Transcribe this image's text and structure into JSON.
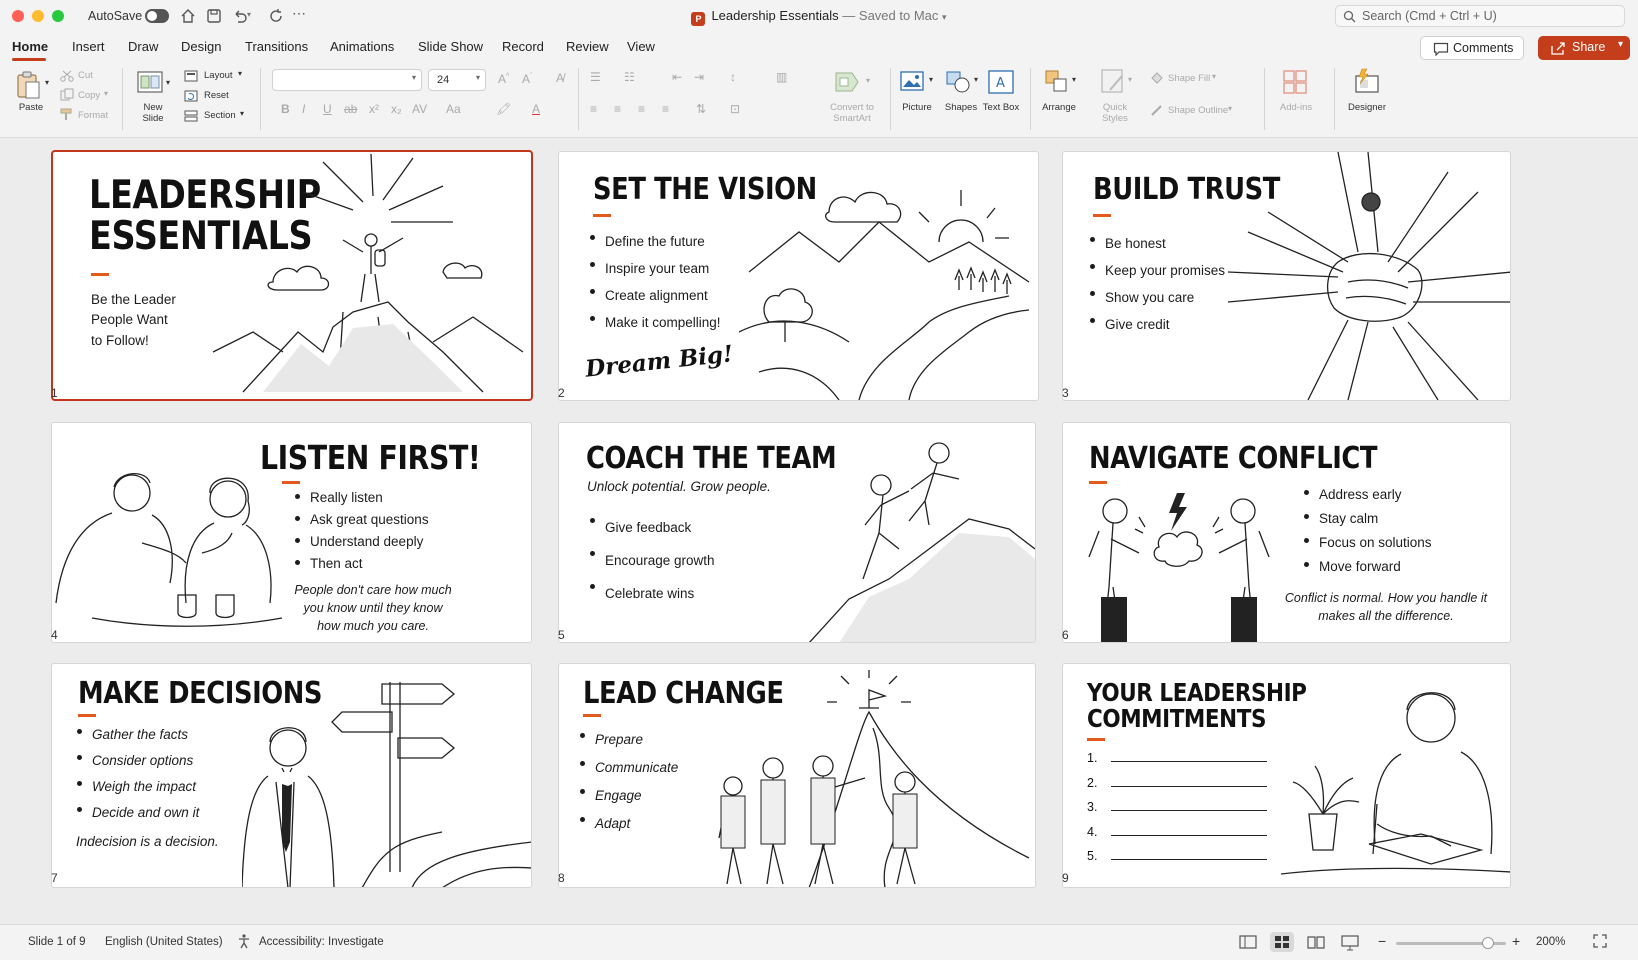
{
  "titlebar": {
    "autosave_label": "AutoSave",
    "document_title": "Leadership Essentials",
    "save_status": "— Saved to Mac",
    "search_placeholder": "Search (Cmd + Ctrl + U)"
  },
  "tabs": [
    "Home",
    "Insert",
    "Draw",
    "Design",
    "Transitions",
    "Animations",
    "Slide Show",
    "Record",
    "Review",
    "View"
  ],
  "active_tab": "Home",
  "header_buttons": {
    "comments": "Comments",
    "share": "Share"
  },
  "ribbon": {
    "paste": "Paste",
    "cut": "Cut",
    "copy": "Copy",
    "format": "Format",
    "new_slide": "New Slide",
    "layout": "Layout",
    "reset": "Reset",
    "section": "Section",
    "font_name": "",
    "font_size": "24",
    "convert_smartart": "Convert to SmartArt",
    "picture": "Picture",
    "shapes": "Shapes",
    "text_box": "Text Box",
    "arrange": "Arrange",
    "quick_styles": "Quick Styles",
    "shape_fill": "Shape Fill",
    "shape_outline": "Shape Outline",
    "add_ins": "Add-ins",
    "designer": "Designer"
  },
  "slides": [
    {
      "number": "1",
      "title_l1": "LEADERSHIP",
      "title_l2": "ESSENTIALS",
      "subtitle": [
        "Be the Leader",
        "People Want",
        "to Follow!"
      ]
    },
    {
      "number": "2",
      "title": "SET THE VISION",
      "bullets": [
        "Define the future",
        "Inspire your team",
        "Create alignment",
        "Make it compelling!"
      ],
      "script_text": "Dream Big!"
    },
    {
      "number": "3",
      "title": "BUILD TRUST",
      "bullets": [
        "Be honest",
        "Keep your promises",
        "Show you care",
        "Give credit"
      ]
    },
    {
      "number": "4",
      "title": "LISTEN FIRST!",
      "bullets": [
        "Really listen",
        "Ask great questions",
        "Understand deeply",
        "Then act"
      ],
      "quote": [
        "People don't care how much",
        "you know until they know",
        "how much you care."
      ]
    },
    {
      "number": "5",
      "title": "COACH THE TEAM",
      "tagline": "Unlock potential. Grow people.",
      "bullets": [
        "Give feedback",
        "Encourage growth",
        "Celebrate wins"
      ]
    },
    {
      "number": "6",
      "title": "NAVIGATE CONFLICT",
      "bullets": [
        "Address early",
        "Stay calm",
        "Focus on solutions",
        "Move forward"
      ],
      "quote": [
        "Conflict is normal. How you handle it",
        "makes all the difference."
      ]
    },
    {
      "number": "7",
      "title": "MAKE DECISIONS",
      "bullets": [
        "Gather the facts",
        "Consider options",
        "Weigh the impact",
        "Decide and own it"
      ],
      "closing": "Indecision is a decision."
    },
    {
      "number": "8",
      "title": "LEAD CHANGE",
      "bullets": [
        "Prepare",
        "Communicate",
        "Engage",
        "Adapt"
      ]
    },
    {
      "number": "9",
      "title_l1": "YOUR LEADERSHIP",
      "title_l2": "COMMITMENTS",
      "lines": [
        "1.",
        "2.",
        "3.",
        "4.",
        "5."
      ]
    }
  ],
  "status": {
    "slide_indicator": "Slide 1 of 9",
    "language": "English (United States)",
    "accessibility": "Accessibility: Investigate",
    "zoom": "200%"
  },
  "colors": {
    "accent": "#c43e1c",
    "slide_bar": "#e25a1c",
    "selection": "#c4361c"
  }
}
